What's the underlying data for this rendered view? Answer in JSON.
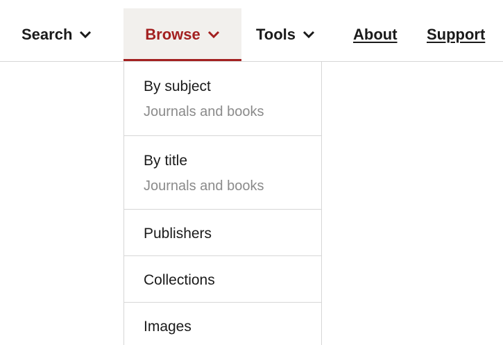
{
  "nav": {
    "search_label": "Search",
    "browse_label": "Browse",
    "tools_label": "Tools",
    "about_label": "About",
    "support_label": "Support",
    "chevron_icon": "chevron-down-icon",
    "active_color": "#a32020"
  },
  "dropdown": {
    "items": [
      {
        "title": "By subject",
        "subtitle": "Journals and books"
      },
      {
        "title": "By title",
        "subtitle": "Journals and books"
      },
      {
        "title": "Publishers"
      },
      {
        "title": "Collections"
      },
      {
        "title": "Images"
      }
    ]
  }
}
